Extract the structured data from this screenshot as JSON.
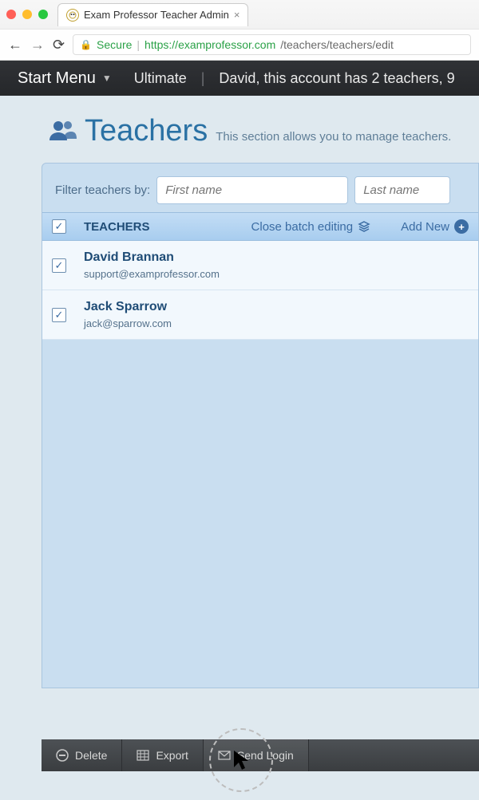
{
  "browser": {
    "tab_title": "Exam Professor Teacher Admin",
    "secure_label": "Secure",
    "url_host": "https://examprofessor.com",
    "url_path": "/teachers/teachers/edit"
  },
  "topbar": {
    "start_menu": "Start Menu",
    "plan": "Ultimate",
    "notice": "David, this account has 2 teachers, 9"
  },
  "section": {
    "title": "Teachers",
    "subtitle": "This section allows you to manage teachers."
  },
  "filter": {
    "label": "Filter teachers by:",
    "first_placeholder": "First name",
    "last_placeholder": "Last name"
  },
  "table": {
    "header_label": "TEACHERS",
    "close_batch": "Close batch editing",
    "add_new": "Add New"
  },
  "teachers": [
    {
      "name": "David Brannan",
      "email": "support@examprofessor.com"
    },
    {
      "name": "Jack Sparrow",
      "email": "jack@sparrow.com"
    }
  ],
  "footer": {
    "delete": "Delete",
    "export": "Export",
    "send_login": "Send Login"
  }
}
